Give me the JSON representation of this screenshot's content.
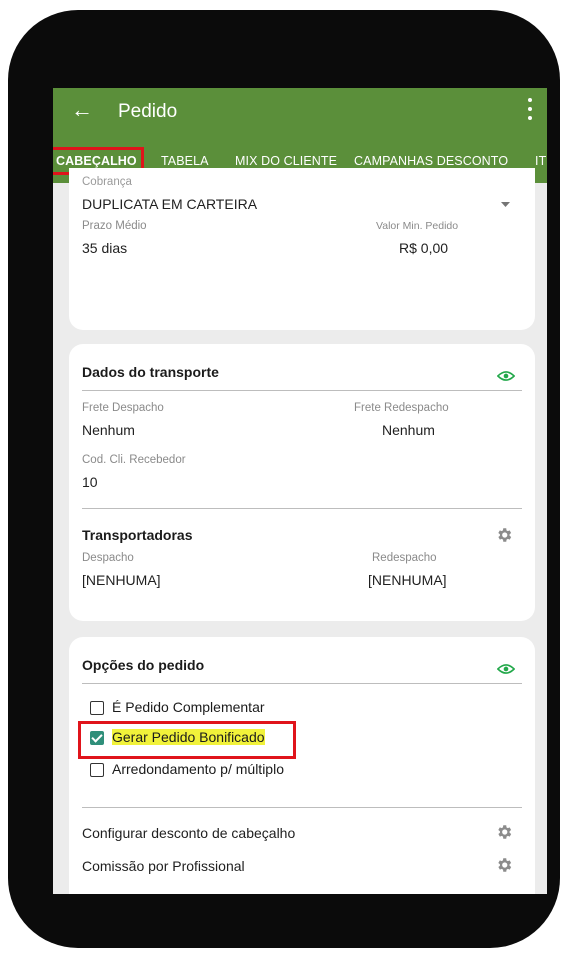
{
  "header": {
    "back_icon": "arrow-left-icon",
    "title": "Pedido",
    "menu_icon": "more-vert-icon"
  },
  "tabs": [
    "CABEÇALHO",
    "TABELA",
    "MIX DO CLIENTE",
    "CAMPANHAS DESCONTO",
    "IT"
  ],
  "active_tab": "CABEÇALHO",
  "payment": {
    "cut_label": "Cobrança",
    "value": "DUPLICATA EM CARTEIRA",
    "prazo_label": "Prazo Médio",
    "prazo_value": "35 dias",
    "valor_min_label": "Valor Min. Pedido",
    "valor_min_value": "R$ 0,00"
  },
  "transport": {
    "title": "Dados do transporte",
    "frete_despacho_label": "Frete Despacho",
    "frete_despacho_value": "Nenhum",
    "frete_redespacho_label": "Frete Redespacho",
    "frete_redespacho_value": "Nenhum",
    "cod_label": "Cod. Cli. Recebedor",
    "cod_value": "10",
    "transportadoras_title": "Transportadoras",
    "despacho_label": "Despacho",
    "despacho_value": "[NENHUMA]",
    "redespacho_label": "Redespacho",
    "redespacho_value": "[NENHUMA]"
  },
  "options": {
    "title": "Opções do pedido",
    "checkboxes": [
      {
        "label": "É Pedido Complementar",
        "checked": false
      },
      {
        "label": "Gerar Pedido Bonificado",
        "checked": true
      },
      {
        "label": "Arredondamento p/ múltiplo",
        "checked": false
      }
    ],
    "config_desconto": "Configurar desconto de cabeçalho",
    "comissao": "Comissão por Profissional"
  },
  "colors": {
    "appbar": "#5b8f3a",
    "highlight_box": "#e0141b",
    "eye": "#22a84a",
    "text_highlight": "#f1f23a",
    "checkbox_checked": "#2f8f7a"
  }
}
